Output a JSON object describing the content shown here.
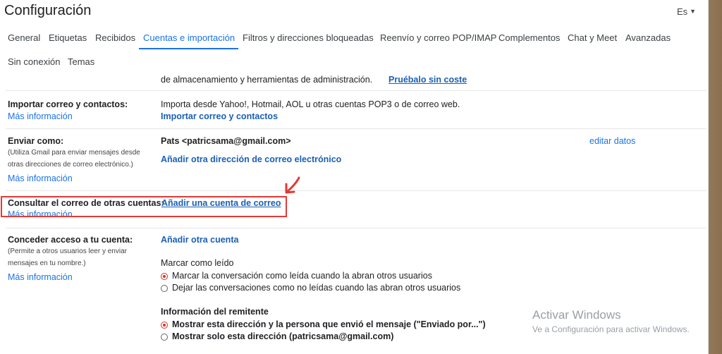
{
  "header": {
    "title": "Configuración",
    "language": "Es"
  },
  "tabs": [
    {
      "label": "General"
    },
    {
      "label": "Etiquetas"
    },
    {
      "label": "Recibidos"
    },
    {
      "label": "Cuentas e importación"
    },
    {
      "label": "Filtros y direcciones bloqueadas"
    },
    {
      "label": "Reenvío y correo POP/IMAP"
    },
    {
      "label": "Complementos"
    },
    {
      "label": "Chat y Meet"
    },
    {
      "label": "Avanzadas"
    },
    {
      "label": "Sin conexión"
    },
    {
      "label": "Temas"
    }
  ],
  "storage": {
    "text": "de almacenamiento y herramientas de administración.",
    "link": "Pruébalo sin coste"
  },
  "import_section": {
    "label": "Importar correo y contactos:",
    "more": "Más información",
    "description": "Importa desde Yahoo!, Hotmail, AOL u otras cuentas POP3 o de correo web.",
    "action": "Importar correo y contactos"
  },
  "send_as": {
    "label": "Enviar como:",
    "sub": "(Utiliza Gmail para enviar mensajes desde otras direcciones de correo electrónico.)",
    "more": "Más información",
    "identity": "Pats <patricsama@gmail.com>",
    "edit": "editar datos",
    "add": "Añadir otra dirección de correo electrónico"
  },
  "check_mail": {
    "label": "Consultar el correo de otras cuentas:",
    "more": "Más información",
    "add": "Añadir una cuenta de correo"
  },
  "grant_access": {
    "label": "Conceder acceso a tu cuenta:",
    "sub": "(Permite a otros usuarios leer y enviar mensajes en tu nombre.)",
    "more": "Más información",
    "add": "Añadir otra cuenta",
    "mark_read_title": "Marcar como leído",
    "mark_read_opt1": "Marcar la conversación como leída cuando la abran otros usuarios",
    "mark_read_opt2": "Dejar las conversaciones como no leídas cuando las abran otros usuarios",
    "sender_info_title": "Información del remitente",
    "sender_opt1": "Mostrar esta dirección y la persona que envió el mensaje (\"Enviado por...\")",
    "sender_opt2": "Mostrar solo esta dirección (patricsama@gmail.com)"
  },
  "watermark": {
    "line1": "Activar Windows",
    "line2": "Ve a Configuración para activar Windows."
  },
  "colors": {
    "accent": "#1a73e8",
    "annotation": "#e53935",
    "radio_on": "#d93025"
  }
}
